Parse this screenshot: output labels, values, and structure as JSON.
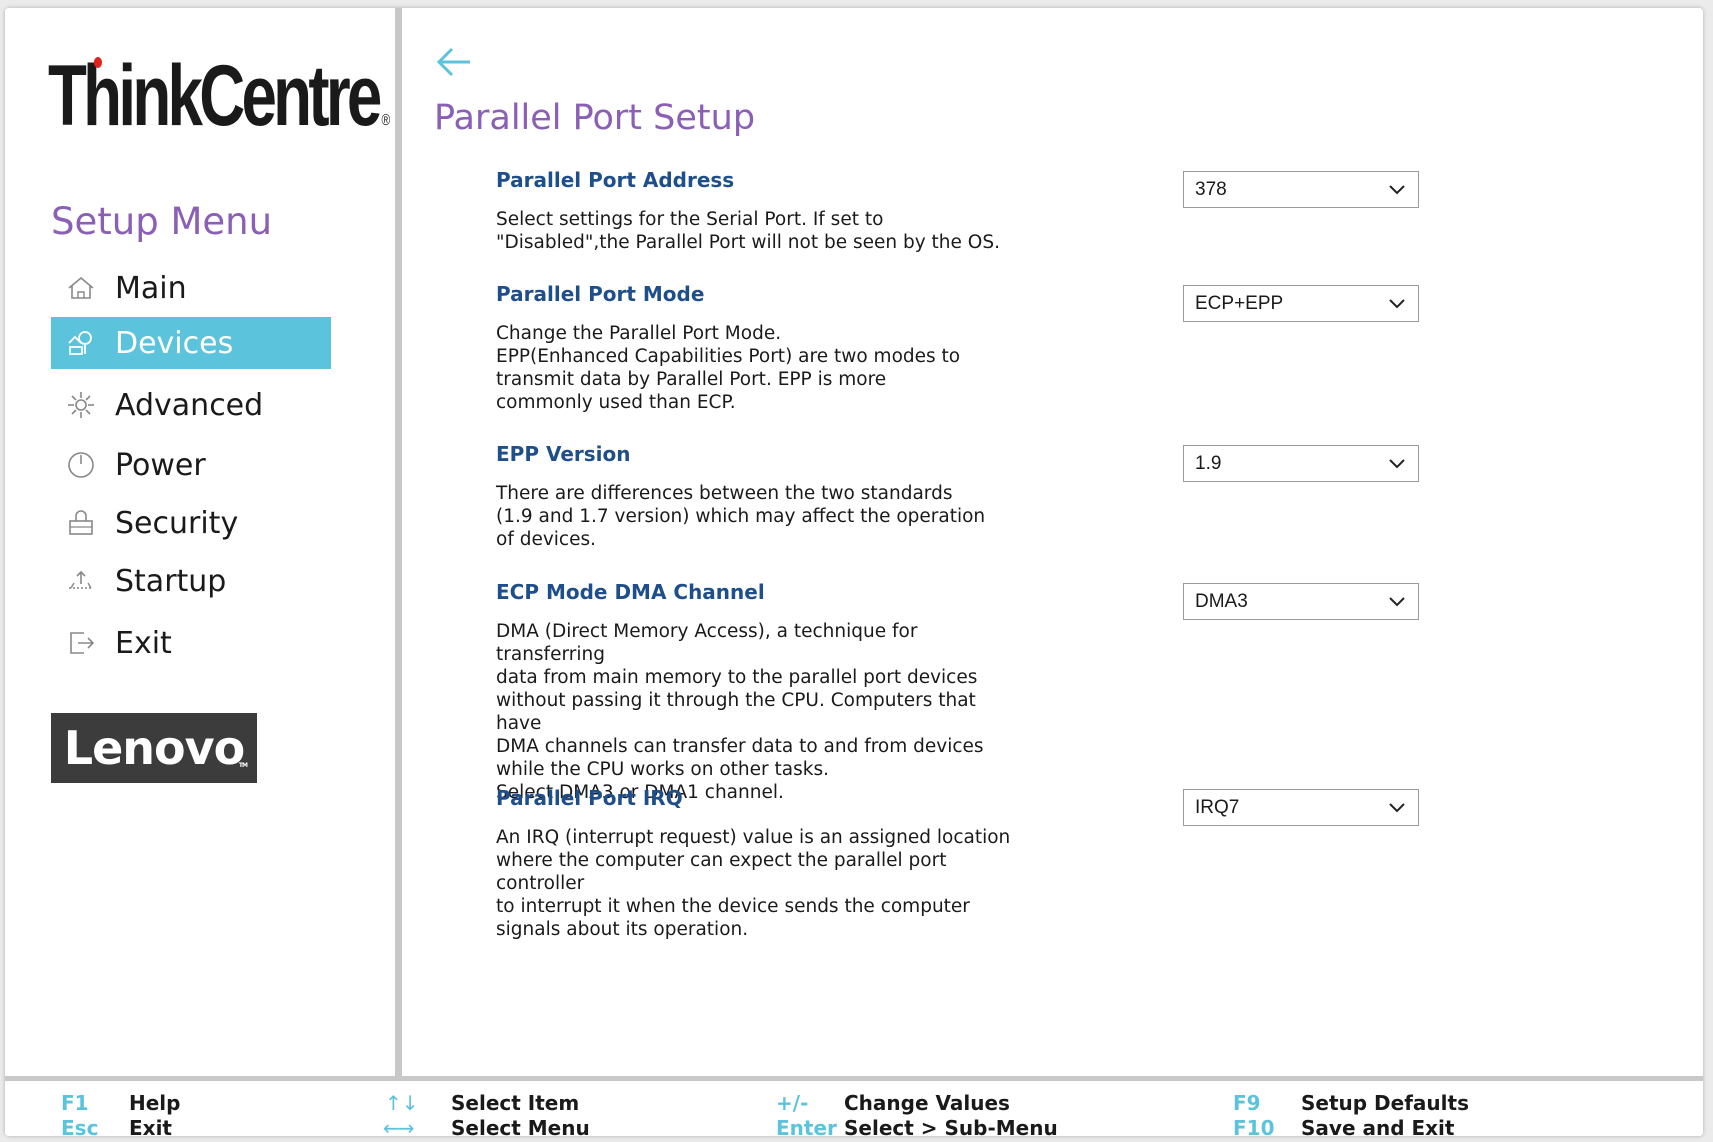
{
  "brand": {
    "product_logo": "ThinkCentre",
    "vendor_logo": "Lenovo"
  },
  "sidebar": {
    "title": "Setup Menu",
    "items": [
      {
        "label": "Main",
        "icon": "home-icon",
        "active": false
      },
      {
        "label": "Devices",
        "icon": "devices-icon",
        "active": true
      },
      {
        "label": "Advanced",
        "icon": "advanced-gear-icon",
        "active": false
      },
      {
        "label": "Power",
        "icon": "power-icon",
        "active": false
      },
      {
        "label": "Security",
        "icon": "lock-icon",
        "active": false
      },
      {
        "label": "Startup",
        "icon": "startup-icon",
        "active": false
      },
      {
        "label": "Exit",
        "icon": "exit-icon",
        "active": false
      }
    ]
  },
  "page": {
    "title": "Parallel Port Setup",
    "settings": [
      {
        "label": "Parallel Port Address",
        "value": "378",
        "description": "Select settings for the Serial Port. If set to\n\"Disabled\",the Parallel Port will not be seen by the OS."
      },
      {
        "label": "Parallel Port Mode",
        "value": "ECP+EPP",
        "description": "Change the Parallel Port Mode.\nEPP(Enhanced Capabilities Port) are two modes to\ntransmit data by Parallel Port. EPP is more\ncommonly used than ECP."
      },
      {
        "label": "EPP Version",
        "value": "1.9",
        "description": "There are differences between the two standards\n(1.9 and 1.7 version) which may affect the operation\nof devices."
      },
      {
        "label": "ECP Mode DMA Channel",
        "value": "DMA3",
        "description": "DMA (Direct Memory Access), a technique for transferring\ndata from main memory to the parallel port devices\nwithout passing it through the CPU. Computers that have\nDMA channels can transfer data to and from devices\nwhile the CPU works on other tasks.\nSelect DMA3 or DMA1 channel."
      },
      {
        "label": "Parallel Port IRQ",
        "value": "IRQ7",
        "description": "An IRQ (interrupt request) value is an assigned location\nwhere the computer can expect the parallel port controller\nto interrupt it when the device sends the computer\nsignals about its operation."
      }
    ]
  },
  "footer": {
    "keys": [
      {
        "key": "F1",
        "desc": "Help"
      },
      {
        "key": "Esc",
        "desc": "Exit"
      },
      {
        "key": "↑↓",
        "desc": "Select Item"
      },
      {
        "key": "←→",
        "desc": "Select Menu"
      },
      {
        "key": "+/-",
        "desc": "Change Values"
      },
      {
        "key": "Enter",
        "desc": "Select > Sub-Menu"
      },
      {
        "key": "F9",
        "desc": "Setup Defaults"
      },
      {
        "key": "F10",
        "desc": "Save and Exit"
      }
    ]
  },
  "colors": {
    "accent_cyan": "#5bc3dc",
    "title_purple": "#8a5fb5",
    "label_blue": "#1f4f8a"
  }
}
